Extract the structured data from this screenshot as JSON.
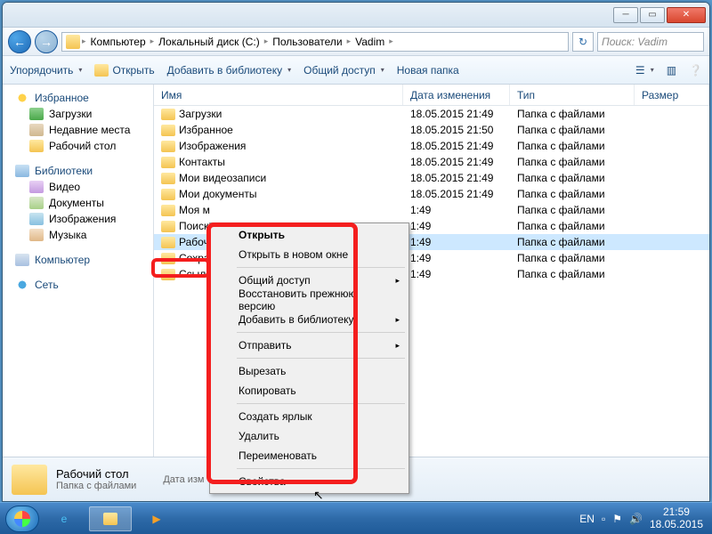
{
  "breadcrumb": [
    "Компьютер",
    "Локальный диск (C:)",
    "Пользователи",
    "Vadim"
  ],
  "search_placeholder": "Поиск: Vadim",
  "toolbar": {
    "organize": "Упорядочить",
    "open": "Открыть",
    "addlib": "Добавить в библиотеку",
    "share": "Общий доступ",
    "newfolder": "Новая папка"
  },
  "sidebar": {
    "favorites": "Избранное",
    "fav_items": [
      "Загрузки",
      "Недавние места",
      "Рабочий стол"
    ],
    "libraries": "Библиотеки",
    "lib_items": [
      "Видео",
      "Документы",
      "Изображения",
      "Музыка"
    ],
    "computer": "Компьютер",
    "network": "Сеть"
  },
  "cols": {
    "name": "Имя",
    "date": "Дата изменения",
    "type": "Тип",
    "size": "Размер"
  },
  "rows": [
    {
      "name": "Загрузки",
      "date": "18.05.2015 21:49",
      "type": "Папка с файлами"
    },
    {
      "name": "Избранное",
      "date": "18.05.2015 21:50",
      "type": "Папка с файлами"
    },
    {
      "name": "Изображения",
      "date": "18.05.2015 21:49",
      "type": "Папка с файлами"
    },
    {
      "name": "Контакты",
      "date": "18.05.2015 21:49",
      "type": "Папка с файлами"
    },
    {
      "name": "Мои видеозаписи",
      "date": "18.05.2015 21:49",
      "type": "Папка с файлами"
    },
    {
      "name": "Мои документы",
      "date": "18.05.2015 21:49",
      "type": "Папка с файлами"
    },
    {
      "name": "Моя м",
      "date": "1:49",
      "type": "Папка с файлами"
    },
    {
      "name": "Поиск",
      "date": "1:49",
      "type": "Папка с файлами"
    },
    {
      "name": "Рабочи",
      "date": "1:49",
      "type": "Папка с файлами",
      "sel": true
    },
    {
      "name": "Сохра",
      "date": "1:49",
      "type": "Папка с файлами"
    },
    {
      "name": "Ссылк",
      "date": "1:49",
      "type": "Папка с файлами"
    }
  ],
  "ctx": {
    "open": "Открыть",
    "opennew": "Открыть в новом окне",
    "share": "Общий доступ",
    "restore": "Восстановить прежнюю версию",
    "addlib": "Добавить в библиотеку",
    "send": "Отправить",
    "cut": "Вырезать",
    "copy": "Копировать",
    "shortcut": "Создать ярлык",
    "delete": "Удалить",
    "rename": "Переименовать",
    "props": "Свойства"
  },
  "details": {
    "title": "Рабочий стол",
    "type": "Папка с файлами",
    "meta": "Дата изм"
  },
  "tray": {
    "lang": "EN",
    "time": "21:59",
    "date": "18.05.2015"
  }
}
